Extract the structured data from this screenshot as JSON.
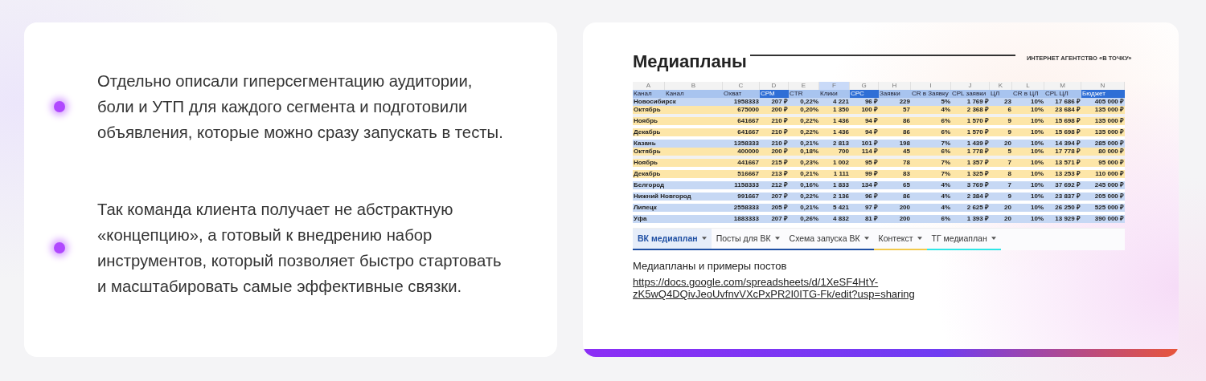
{
  "points": [
    {
      "text": "Отдельно описали гиперсегментацию аудитории,\nболи и УТП для каждого сегмента и подготовили\nобъявления, которые можно сразу запускать в тесты."
    },
    {
      "text": "Так команда клиента получает не абстрактную\n«концепцию», а готовый к внедрению набор\nинструментов, который позволяет быстро стартовать\nи масштабировать самые эффективные связки."
    }
  ],
  "slide": {
    "title": "Медиапланы",
    "agency": "ИНТЕРНЕТ АГЕНТСТВО «В ТОЧКУ»",
    "sheet": {
      "column_letters": [
        {
          "label": "A",
          "selected": false
        },
        {
          "label": "B",
          "selected": false
        },
        {
          "label": "C",
          "selected": false
        },
        {
          "label": "D",
          "selected": false
        },
        {
          "label": "E",
          "selected": false
        },
        {
          "label": "F",
          "selected": true
        },
        {
          "label": "G",
          "selected": false
        },
        {
          "label": "H",
          "selected": false
        },
        {
          "label": "I",
          "selected": false
        },
        {
          "label": "J",
          "selected": false
        },
        {
          "label": "K",
          "selected": false
        },
        {
          "label": "L",
          "selected": false
        },
        {
          "label": "M",
          "selected": false
        },
        {
          "label": "N",
          "selected": false
        }
      ],
      "headers": [
        {
          "label": "Канал",
          "highlight": false
        },
        {
          "label": "Канал",
          "highlight": false
        },
        {
          "label": "Охват",
          "highlight": false
        },
        {
          "label": "CPM",
          "highlight": true
        },
        {
          "label": "CTR",
          "highlight": false
        },
        {
          "label": "Клики",
          "highlight": false
        },
        {
          "label": "CPC",
          "highlight": true
        },
        {
          "label": "Заявки",
          "highlight": false
        },
        {
          "label": "CR в Заявку",
          "highlight": false
        },
        {
          "label": "CPL заявки",
          "highlight": false
        },
        {
          "label": "ЦЛ",
          "highlight": false
        },
        {
          "label": "CR в ЦЛ",
          "highlight": false
        },
        {
          "label": "CPL ЦЛ",
          "highlight": false
        },
        {
          "label": "Бюджет",
          "highlight": true
        }
      ],
      "rows": [
        {
          "kind": "city",
          "cells": [
            "Новосибирск",
            "1958333",
            "207 ₽",
            "0,22%",
            "4 221",
            "96 ₽",
            "229",
            "5%",
            "1 769 ₽",
            "23",
            "10%",
            "17 686 ₽",
            "405 000 ₽"
          ]
        },
        {
          "kind": "month",
          "cells": [
            "Октябрь",
            "675000",
            "200 ₽",
            "0,20%",
            "1 350",
            "100 ₽",
            "57",
            "4%",
            "2 368 ₽",
            "6",
            "10%",
            "23 684 ₽",
            "135 000 ₽"
          ]
        },
        {
          "kind": "gap"
        },
        {
          "kind": "month",
          "cells": [
            "Ноябрь",
            "641667",
            "210 ₽",
            "0,22%",
            "1 436",
            "94 ₽",
            "86",
            "6%",
            "1 570 ₽",
            "9",
            "10%",
            "15 698 ₽",
            "135 000 ₽"
          ]
        },
        {
          "kind": "blank"
        },
        {
          "kind": "month",
          "cells": [
            "Декабрь",
            "641667",
            "210 ₽",
            "0,22%",
            "1 436",
            "94 ₽",
            "86",
            "6%",
            "1 570 ₽",
            "9",
            "10%",
            "15 698 ₽",
            "135 000 ₽"
          ]
        },
        {
          "kind": "blank"
        },
        {
          "kind": "city",
          "cells": [
            "Казань",
            "1358333",
            "210 ₽",
            "0,21%",
            "2 813",
            "101 ₽",
            "198",
            "7%",
            "1 439 ₽",
            "20",
            "10%",
            "14 394 ₽",
            "285 000 ₽"
          ]
        },
        {
          "kind": "month",
          "cells": [
            "Октябрь",
            "400000",
            "200 ₽",
            "0,18%",
            "700",
            "114 ₽",
            "45",
            "6%",
            "1 778 ₽",
            "5",
            "10%",
            "17 778 ₽",
            "80 000 ₽"
          ]
        },
        {
          "kind": "gap"
        },
        {
          "kind": "month",
          "cells": [
            "Ноябрь",
            "441667",
            "215 ₽",
            "0,23%",
            "1 002",
            "95 ₽",
            "78",
            "7%",
            "1 357 ₽",
            "7",
            "10%",
            "13 571 ₽",
            "95 000 ₽"
          ]
        },
        {
          "kind": "blank"
        },
        {
          "kind": "month",
          "cells": [
            "Декабрь",
            "516667",
            "213 ₽",
            "0,21%",
            "1 111",
            "99 ₽",
            "83",
            "7%",
            "1 325 ₽",
            "8",
            "10%",
            "13 253 ₽",
            "110 000 ₽"
          ]
        },
        {
          "kind": "blank"
        },
        {
          "kind": "city",
          "cells": [
            "Белгород",
            "1158333",
            "212 ₽",
            "0,16%",
            "1 833",
            "134 ₽",
            "65",
            "4%",
            "3 769 ₽",
            "7",
            "10%",
            "37 692 ₽",
            "245 000 ₽"
          ]
        },
        {
          "kind": "blank"
        },
        {
          "kind": "city",
          "cells": [
            "Нижний Новгород",
            "991667",
            "207 ₽",
            "0,22%",
            "2 136",
            "96 ₽",
            "86",
            "4%",
            "2 384 ₽",
            "9",
            "10%",
            "23 837 ₽",
            "205 000 ₽"
          ]
        },
        {
          "kind": "blank"
        },
        {
          "kind": "city",
          "cells": [
            "Липецк",
            "2558333",
            "205 ₽",
            "0,21%",
            "5 421",
            "97 ₽",
            "200",
            "4%",
            "2 625 ₽",
            "20",
            "10%",
            "26 250 ₽",
            "525 000 ₽"
          ]
        },
        {
          "kind": "blank"
        },
        {
          "kind": "city",
          "cells": [
            "Уфа",
            "1883333",
            "207 ₽",
            "0,26%",
            "4 832",
            "81 ₽",
            "200",
            "6%",
            "1 393 ₽",
            "20",
            "10%",
            "13 929 ₽",
            "390 000 ₽"
          ]
        }
      ],
      "tabs": [
        {
          "label": "ВК медиаплан",
          "selected": true,
          "color": "#1f4fa3"
        },
        {
          "label": "Посты для ВК",
          "selected": false,
          "color": "#1f4fa3"
        },
        {
          "label": "Схема запуска ВК",
          "selected": false,
          "color": "#1f4fa3"
        },
        {
          "label": "Контекст",
          "selected": false,
          "color": "#f2c94c"
        },
        {
          "label": "ТГ медиаплан",
          "selected": false,
          "color": "#2ee6e6"
        }
      ]
    },
    "caption": "Медиапланы и примеры постов",
    "link": "https://docs.google.com/spreadsheets/d/1XeSF4HtY-zK5wQ4DQivJeoUvfnvVXcPxPR2I0ITG-Fk/edit?usp=sharing"
  }
}
